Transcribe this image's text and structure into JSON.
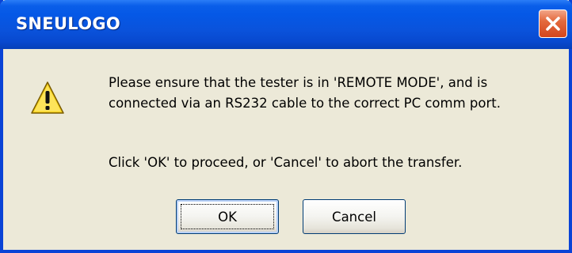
{
  "window": {
    "title": "SNEULOGO",
    "close_icon": "close-icon"
  },
  "dialog": {
    "icon": "warning-icon",
    "message_line1": "Please ensure that the tester is in 'REMOTE MODE', and is",
    "message_line2": "connected via an RS232 cable to the correct PC comm port.",
    "message_line3": "Click 'OK' to proceed, or 'Cancel' to abort the transfer."
  },
  "buttons": {
    "ok_label": "OK",
    "cancel_label": "Cancel"
  },
  "colors": {
    "titlebar": "#0558e6",
    "close_button": "#d4461e",
    "dialog_background": "#ece9d8"
  }
}
